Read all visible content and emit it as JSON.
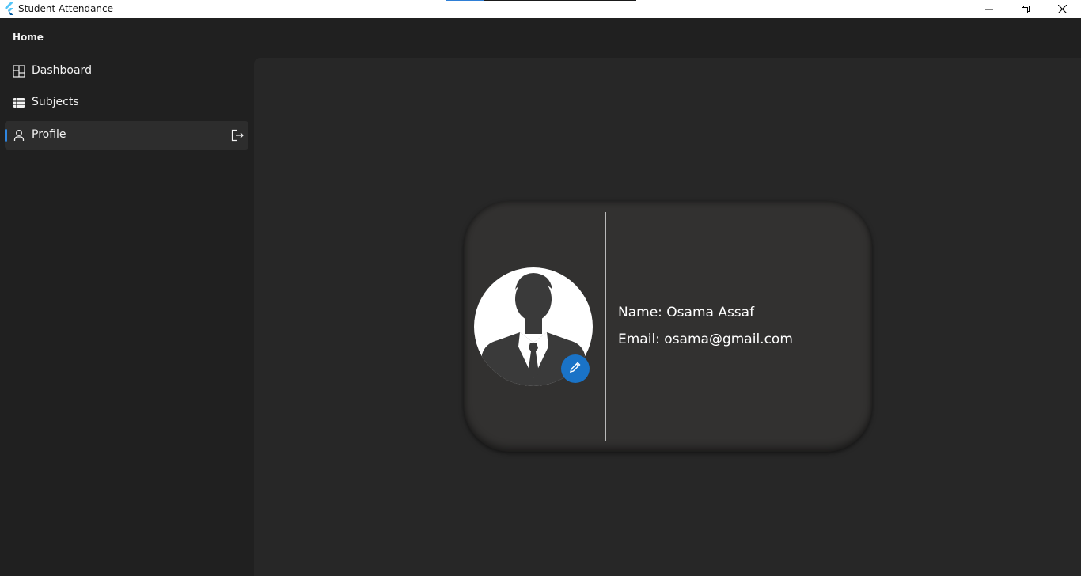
{
  "window": {
    "title": "Student Attendance",
    "progress_fraction": 0.2,
    "accent_color": "#2f7fd6",
    "icons": {
      "app": "flutter-logo-icon",
      "minimize": "minimize-icon",
      "maximize": "restore-icon",
      "close": "close-icon"
    }
  },
  "sidebar": {
    "header": "Home",
    "items": [
      {
        "label": "Dashboard",
        "icon": "dashboard-icon",
        "active": false
      },
      {
        "label": "Subjects",
        "icon": "list-icon",
        "active": false
      },
      {
        "label": "Profile",
        "icon": "person-icon",
        "active": true,
        "trailing_icon": "logout-icon"
      }
    ],
    "indicator_color": "#2f86e0"
  },
  "profile": {
    "avatar_icon": "person-silhouette-icon",
    "edit_icon": "pencil-icon",
    "edit_button_color": "#1a73c7",
    "name_line": "Name: Osama Assaf",
    "email_line": "Email: osama@gmail.com"
  }
}
